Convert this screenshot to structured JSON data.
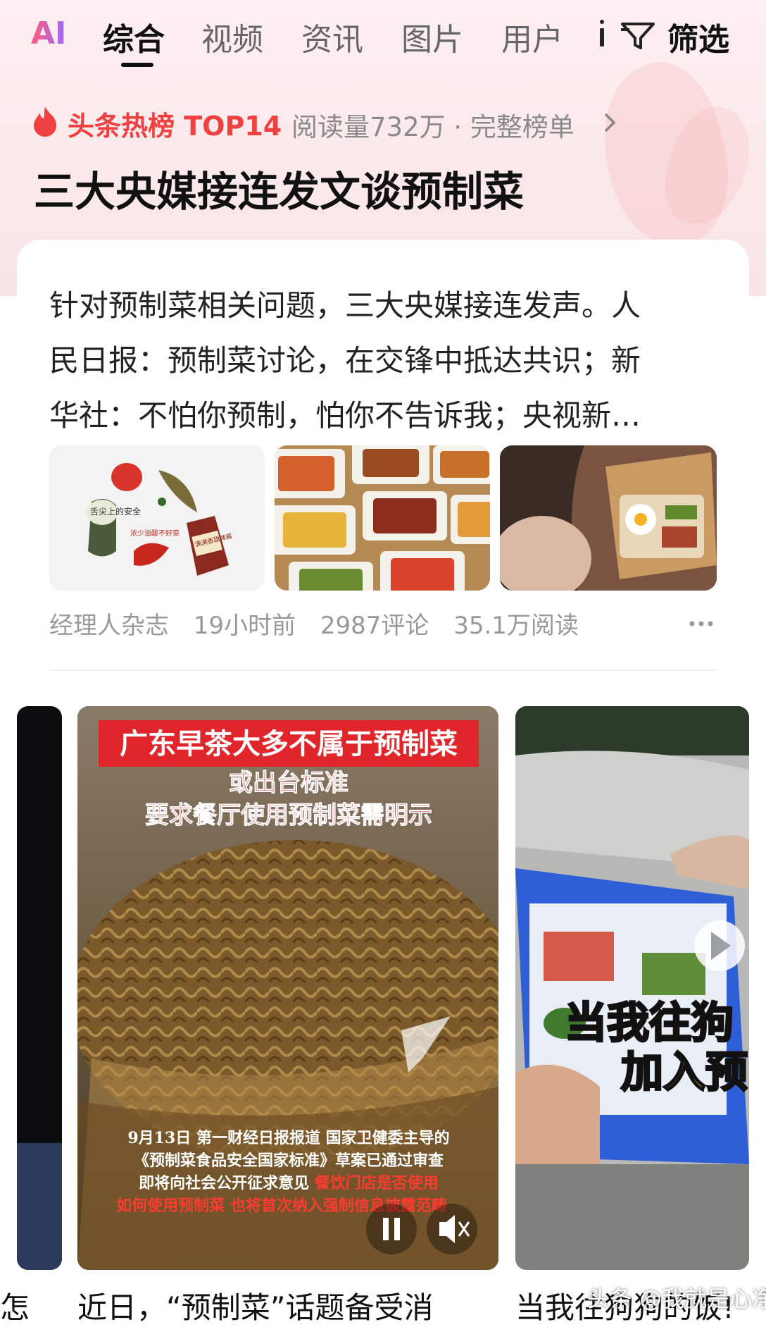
{
  "tabs": {
    "ai_label": "AI",
    "items": [
      {
        "label": "综合",
        "active": true
      },
      {
        "label": "视频",
        "active": false
      },
      {
        "label": "资讯",
        "active": false
      },
      {
        "label": "图片",
        "active": false
      },
      {
        "label": "用户",
        "active": false
      }
    ],
    "filter_label": "筛选"
  },
  "hot": {
    "label": "头条热榜 TOP14",
    "meta": "阅读量732万 · 完整榜单",
    "title": "三大央媒接连发文谈预制菜"
  },
  "article": {
    "summary_lines": [
      "针对预制菜相关问题，三大央媒接连发声。人",
      "民日报：预制菜讨论，在交锋中抵达共识；新",
      "华社：不怕你预制，怕你不告诉我；央视新…"
    ],
    "image1_labels": [
      "舌尖上的安全",
      "浓少油酸不好菜",
      "满满香甜辣酱"
    ],
    "source": "经理人杂志",
    "time": "19小时前",
    "comments": "2987评论",
    "reads": "35.1万阅读"
  },
  "videos": {
    "v1": {
      "banner": "广东早茶大多不属于预制菜",
      "sub1": "或出台标准",
      "sub2": "要求餐厅使用预制菜需明示",
      "body_lines": [
        "9月13日 第一财经日报报道 国家卫健委主导的",
        "《预制菜食品安全国家标准》草案已通过审查",
        "即将向社会公开征求意见 ",
        "如何使用预制菜 也将首次纳入强制信息披露范畴"
      ],
      "body_red": "餐饮门店是否使用",
      "caption": "近日，“预制菜”话题备受消"
    },
    "v2": {
      "overlay1": "当我往狗",
      "overlay2": "加入预",
      "caption": "当我往狗狗的饭!"
    },
    "v0_caption": "怎",
    "watermark": "头条 @我就是心净"
  }
}
